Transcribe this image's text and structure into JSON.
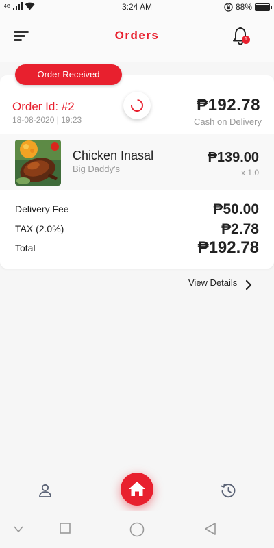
{
  "status_bar": {
    "time": "3:24 AM",
    "network_tag": "4G",
    "battery_percent": "88%",
    "battery_level": 0.88
  },
  "header": {
    "title": "Orders",
    "notification_count": "1"
  },
  "order": {
    "status": "Order Received",
    "id_label": "Order Id: #2",
    "datetime": "18-08-2020 | 19:23",
    "total": "₱192.78",
    "payment_method": "Cash on Delivery",
    "items": [
      {
        "name": "Chicken Inasal",
        "restaurant": "Big Daddy's",
        "price": "₱139.00",
        "quantity": "x 1.0"
      }
    ],
    "fees": [
      {
        "label": "Delivery Fee",
        "value": "₱50.00"
      },
      {
        "label": "TAX (2.0%)",
        "value": "₱2.78"
      },
      {
        "label": "Total",
        "value": "₱192.78"
      }
    ]
  },
  "view_details_label": "View Details",
  "icons": {
    "menu": "menu-icon",
    "bell": "bell-icon",
    "spinner": "loading-icon",
    "chevron": "chevron-right-icon",
    "profile": "user-icon",
    "home": "home-icon",
    "history": "history-icon"
  },
  "colors": {
    "accent": "#e8202e",
    "muted_text": "#999999",
    "nav_icon": "#5a6275"
  }
}
